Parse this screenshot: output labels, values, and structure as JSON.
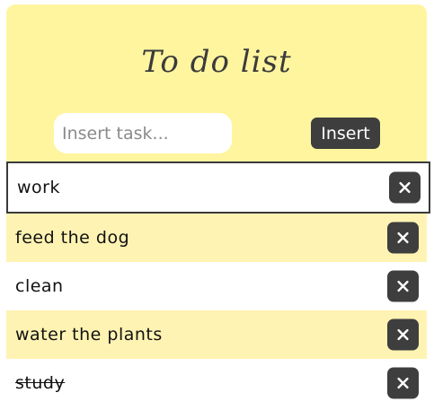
{
  "header": {
    "title": "To do list"
  },
  "form": {
    "input_placeholder": "Insert task...",
    "input_value": "",
    "insert_label": "Insert"
  },
  "tasks": [
    {
      "text": "work",
      "done": false,
      "selected": true
    },
    {
      "text": "feed the dog",
      "done": false,
      "selected": false
    },
    {
      "text": "clean",
      "done": false,
      "selected": false
    },
    {
      "text": "water the plants",
      "done": false,
      "selected": false
    },
    {
      "text": "study",
      "done": true,
      "selected": false
    }
  ],
  "icons": {
    "delete": "close-icon"
  },
  "colors": {
    "header_bg": "#fff59f",
    "row_alt_bg": "#fff3b3",
    "button_bg": "#3e3e3e"
  }
}
